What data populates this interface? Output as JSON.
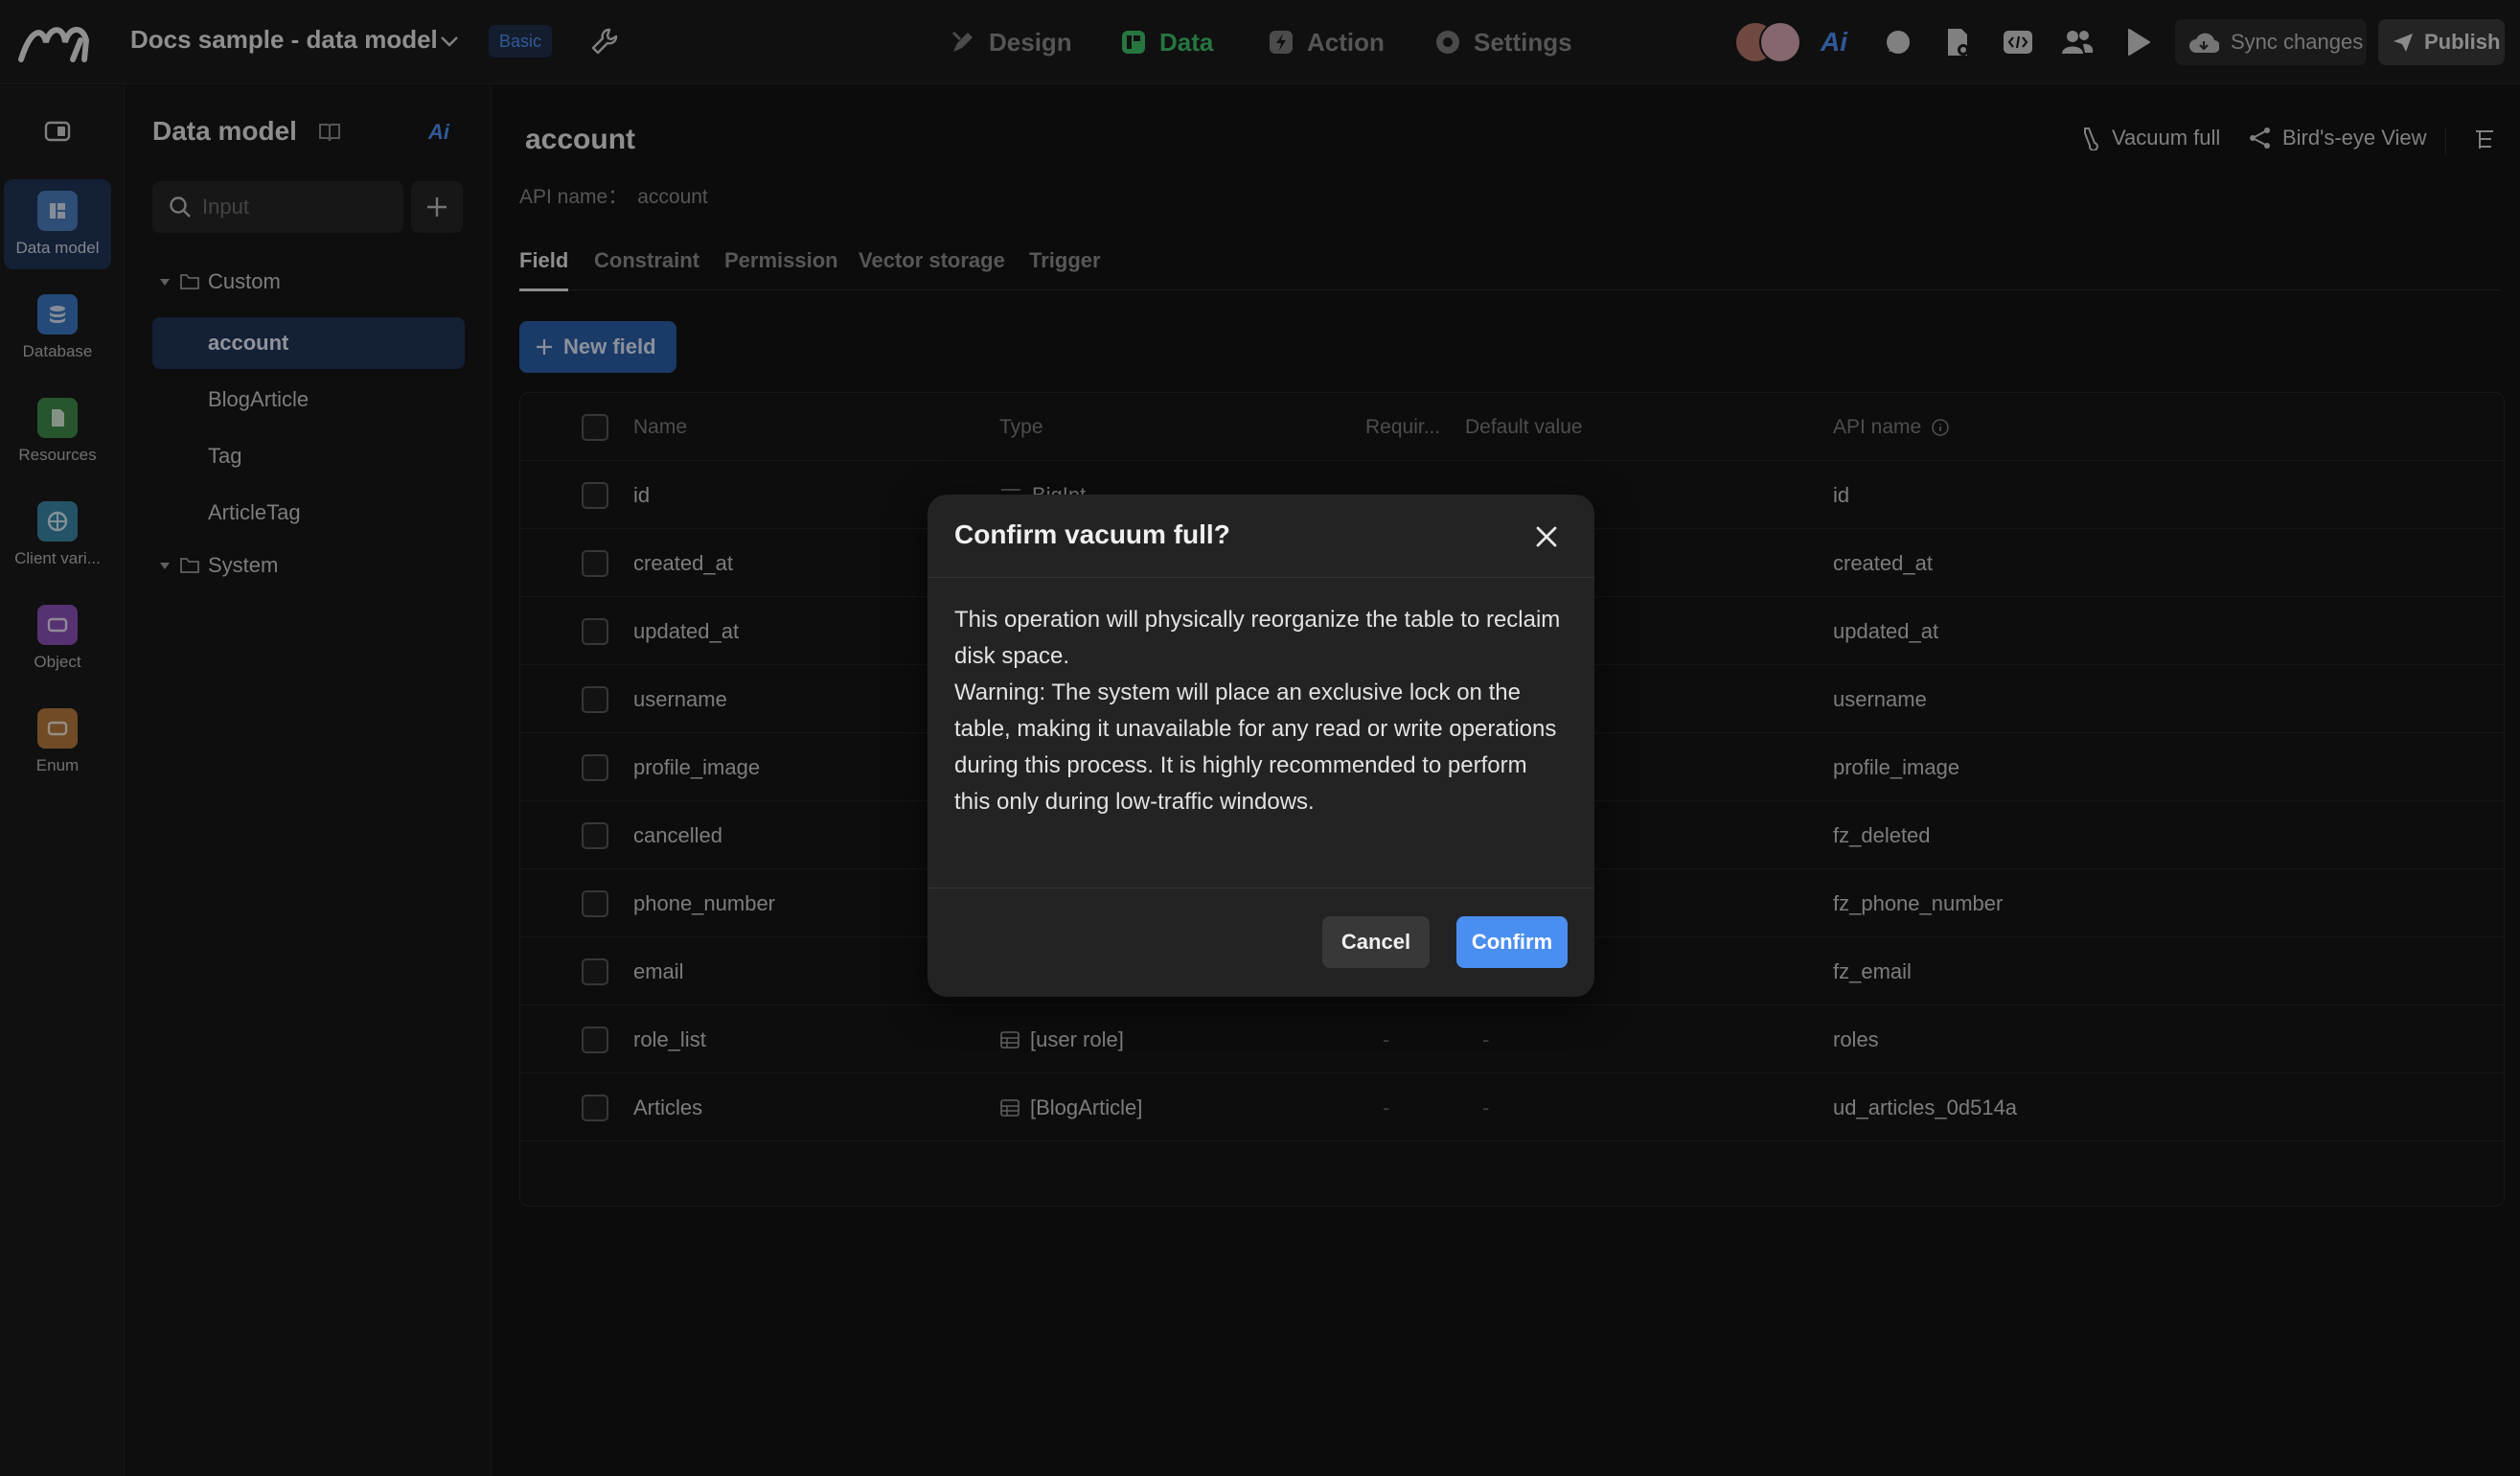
{
  "topbar": {
    "project_title": "Docs sample - data model",
    "plan_badge": "Basic",
    "nav": [
      {
        "label": "Design",
        "icon": "design-icon"
      },
      {
        "label": "Data",
        "icon": "data-icon",
        "active": true
      },
      {
        "label": "Action",
        "icon": "action-icon"
      },
      {
        "label": "Settings",
        "icon": "settings-icon"
      }
    ],
    "ai_label": "Ai",
    "sync_label": "Sync changes",
    "publish_label": "Publish"
  },
  "rail": {
    "items": [
      {
        "label": "Data model",
        "icon": "data-model-icon",
        "color": "#4d7fbf",
        "active": true
      },
      {
        "label": "Database",
        "icon": "database-icon",
        "color": "#3b78c4"
      },
      {
        "label": "Resources",
        "icon": "resources-icon",
        "color": "#3f8a4a"
      },
      {
        "label": "Client vari...",
        "icon": "client-variables-icon",
        "color": "#3a86a8"
      },
      {
        "label": "Object",
        "icon": "object-icon",
        "color": "#8c52b8"
      },
      {
        "label": "Enum",
        "icon": "enum-icon",
        "color": "#b57a3e"
      }
    ]
  },
  "sidebar": {
    "title": "Data model",
    "ai_label": "Ai",
    "search_placeholder": "Input",
    "groups": [
      {
        "label": "Custom",
        "items": [
          "account",
          "BlogArticle",
          "Tag",
          "ArticleTag"
        ]
      },
      {
        "label": "System",
        "items": []
      }
    ],
    "selected": "account"
  },
  "main": {
    "title": "account",
    "api_label": "API name：",
    "api_value": "account",
    "actions": {
      "vacuum": "Vacuum full",
      "birdseye": "Bird's-eye View"
    },
    "tabs": [
      "Field",
      "Constraint",
      "Permission",
      "Vector storage",
      "Trigger"
    ],
    "active_tab": "Field",
    "new_field_label": "New field",
    "table": {
      "headers": {
        "name": "Name",
        "type": "Type",
        "required": "Requir...",
        "default": "Default value",
        "api": "API name"
      },
      "rows": [
        {
          "name": "id",
          "type": "BigInt",
          "required": "-",
          "default": "-",
          "api": "id"
        },
        {
          "name": "created_at",
          "type": "",
          "required": "",
          "default": "",
          "api": "created_at"
        },
        {
          "name": "updated_at",
          "type": "",
          "required": "",
          "default": "",
          "api": "updated_at"
        },
        {
          "name": "username",
          "type": "",
          "required": "",
          "default": "",
          "api": "username"
        },
        {
          "name": "profile_image",
          "type": "",
          "required": "",
          "default": "",
          "api": "profile_image"
        },
        {
          "name": "cancelled",
          "type": "",
          "required": "",
          "default": "",
          "api": "fz_deleted"
        },
        {
          "name": "phone_number",
          "type": "",
          "required": "",
          "default": "",
          "api": "fz_phone_number"
        },
        {
          "name": "email",
          "type": "",
          "required": "",
          "default": "",
          "api": "fz_email"
        },
        {
          "name": "role_list",
          "type": "[user role]",
          "required": "-",
          "default": "-",
          "api": "roles"
        },
        {
          "name": "Articles",
          "type": "[BlogArticle]",
          "required": "-",
          "default": "-",
          "api": "ud_articles_0d514a"
        }
      ]
    }
  },
  "dialog": {
    "title": "Confirm vacuum full?",
    "body_line1": "This operation will physically reorganize the table to reclaim disk space.",
    "body_line2": "Warning: The system will place an exclusive lock on the table, making it unavailable for any read or write operations during this process. It is highly recommended to perform this only during low-traffic windows.",
    "cancel_label": "Cancel",
    "confirm_label": "Confirm"
  },
  "colors": {
    "accent_blue": "#4a8ef0",
    "data_green": "#3fbd6a",
    "selection_bg": "#1f3556"
  }
}
